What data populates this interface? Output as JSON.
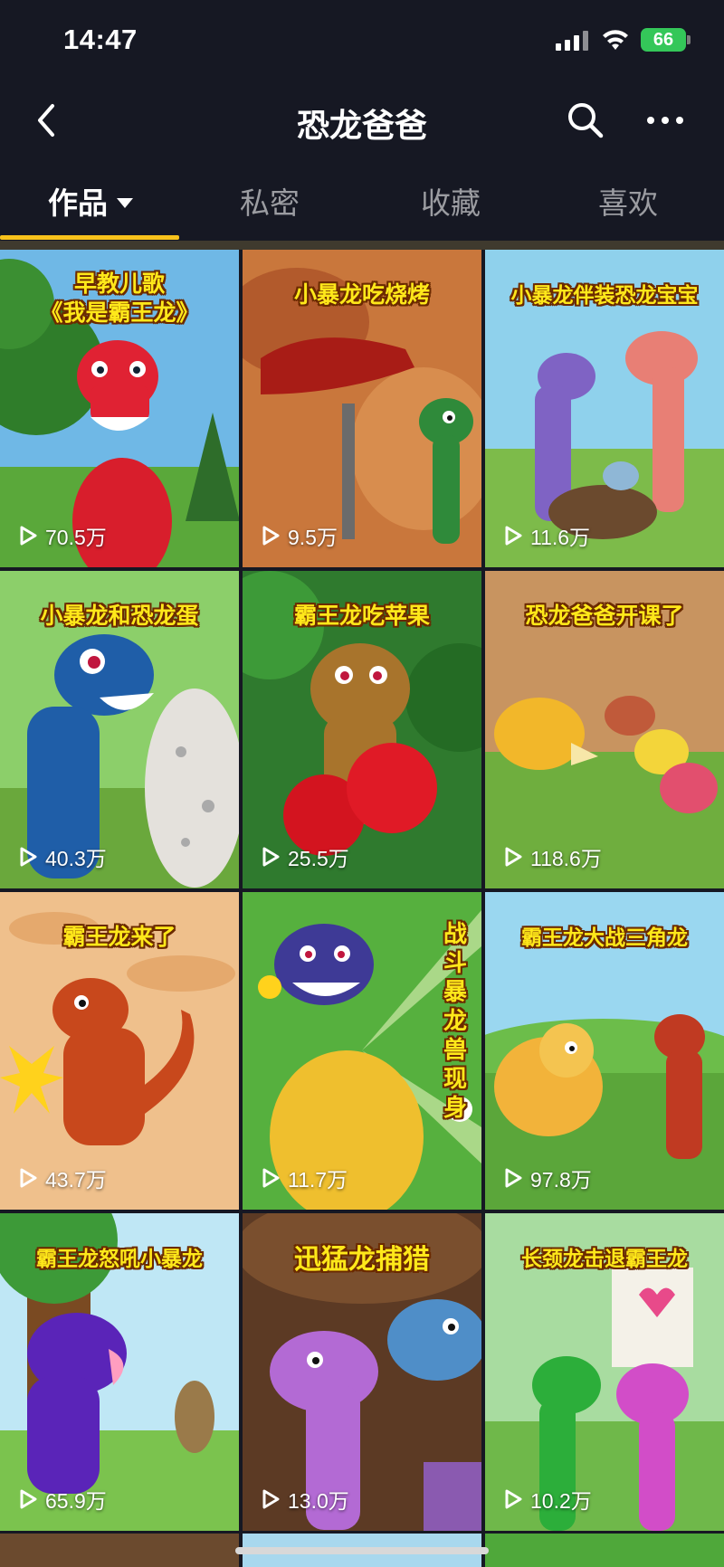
{
  "status_bar": {
    "time": "14:47",
    "battery": "66"
  },
  "nav": {
    "title": "恐龙爸爸"
  },
  "tabs": [
    {
      "label": "作品",
      "active": true
    },
    {
      "label": "私密",
      "active": false
    },
    {
      "label": "收藏",
      "active": false
    },
    {
      "label": "喜欢",
      "active": false
    }
  ],
  "videos": [
    {
      "title": "早教儿歌\n《我是霸王龙》",
      "plays": "70.5万"
    },
    {
      "title": "小暴龙吃烧烤",
      "plays": "9.5万"
    },
    {
      "title": "小暴龙伴装恐龙宝宝",
      "plays": "11.6万"
    },
    {
      "title": "小暴龙和恐龙蛋",
      "plays": "40.3万"
    },
    {
      "title": "霸王龙吃苹果",
      "plays": "25.5万"
    },
    {
      "title": "恐龙爸爸开课了",
      "plays": "118.6万"
    },
    {
      "title": "霸王龙来了",
      "plays": "43.7万"
    },
    {
      "title": "战斗暴龙兽现身",
      "plays": "11.7万"
    },
    {
      "title": "霸王龙大战三角龙",
      "plays": "97.8万"
    },
    {
      "title": "霸王龙怒吼小暴龙",
      "plays": "65.9万"
    },
    {
      "title": "迅猛龙捕猎",
      "plays": "13.0万"
    },
    {
      "title": "长颈龙击退霸王龙",
      "plays": "10.2万"
    }
  ],
  "icons": {
    "back": "chevron-left-icon",
    "search": "search-icon",
    "more": "more-dots-icon",
    "play": "play-icon",
    "signal": "cellular-signal-icon",
    "wifi": "wifi-icon",
    "battery": "battery-icon"
  },
  "colors": {
    "background": "#161823",
    "tab_indicator": "#f8c21b",
    "title_text": "#ffe81a"
  }
}
